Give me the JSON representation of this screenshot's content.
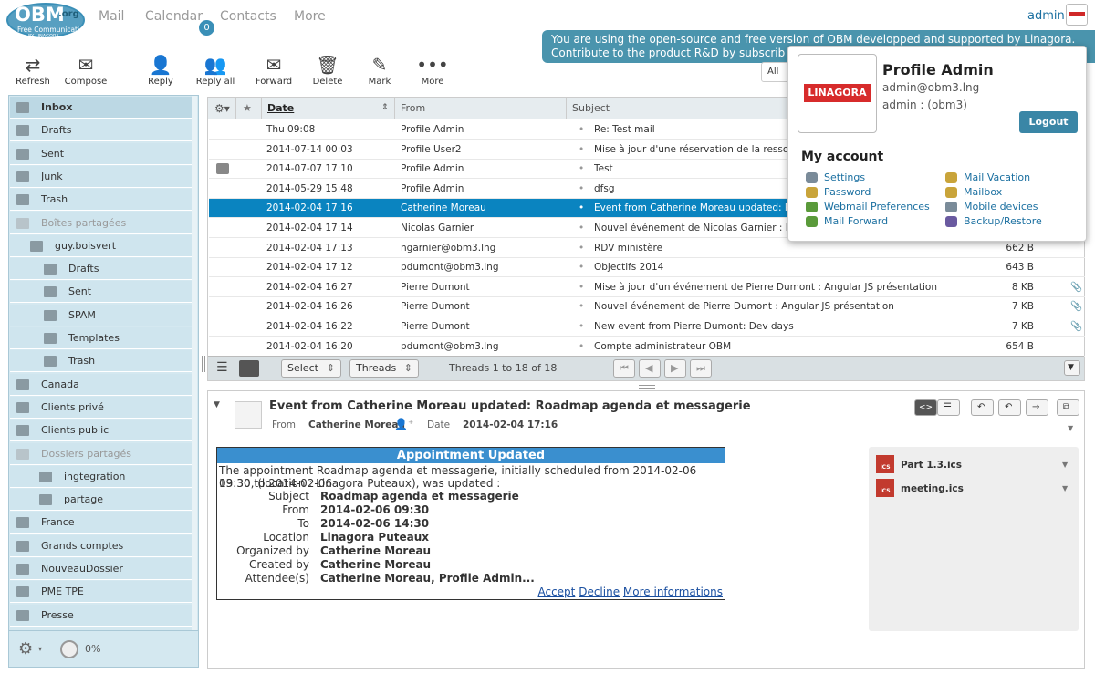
{
  "brand": {
    "logo_text": "OBM",
    "logo_sub": ".org",
    "logo_tagline": "Free Communication",
    "logo_by": "BY LINAGORA"
  },
  "nav": [
    {
      "label": "Mail"
    },
    {
      "label": "Calendar"
    },
    {
      "label": "Contacts"
    },
    {
      "label": "More"
    }
  ],
  "calendar_badge": "0",
  "user": {
    "name": "admin"
  },
  "banner": {
    "line1": "You are using the open-source and free version of OBM developped and supported by Linagora.",
    "line2": "Contribute to the product R&D by subscrib"
  },
  "toolbar": [
    {
      "label": "Refresh",
      "icon": "refresh-icon"
    },
    {
      "label": "Compose",
      "icon": "compose-icon"
    },
    {
      "label": "Reply",
      "icon": "reply-icon"
    },
    {
      "label": "Reply all",
      "icon": "reply-all-icon"
    },
    {
      "label": "Forward",
      "icon": "forward-icon"
    },
    {
      "label": "Delete",
      "icon": "trash-icon"
    },
    {
      "label": "Mark",
      "icon": "mark-icon"
    },
    {
      "label": "More",
      "icon": "more-icon"
    }
  ],
  "filter_value": "All",
  "folders": [
    {
      "label": "Inbox",
      "state": "selected"
    },
    {
      "label": "Drafts"
    },
    {
      "label": "Sent"
    },
    {
      "label": "Junk"
    },
    {
      "label": "Trash"
    },
    {
      "label": "Boîtes partagées",
      "state": "disabled"
    },
    {
      "label": "guy.boisvert"
    },
    {
      "label": "Drafts"
    },
    {
      "label": "Sent"
    },
    {
      "label": "SPAM"
    },
    {
      "label": "Templates"
    },
    {
      "label": "Trash"
    },
    {
      "label": "Canada"
    },
    {
      "label": "Clients privé"
    },
    {
      "label": "Clients public"
    },
    {
      "label": "Dossiers partagés",
      "state": "disabled"
    },
    {
      "label": "ingtegration"
    },
    {
      "label": "partage"
    },
    {
      "label": "France"
    },
    {
      "label": "Grands comptes"
    },
    {
      "label": "NouveauDossier"
    },
    {
      "label": "PME TPE"
    },
    {
      "label": "Presse"
    }
  ],
  "quota": "0%",
  "list": {
    "headers": {
      "date": "Date",
      "from": "From",
      "subject": "Subject"
    },
    "rows": [
      {
        "date": "Thu 09:08",
        "from": "Profile Admin",
        "subject": "Re: Test mail",
        "size": ""
      },
      {
        "date": "2014-07-14 00:03",
        "from": "Profile User2",
        "subject": "Mise à jour d'une réservation de la ressource S",
        "size": ""
      },
      {
        "date": "2014-07-07 17:10",
        "from": "Profile Admin",
        "subject": "Test",
        "size": ""
      },
      {
        "date": "2014-05-29 15:48",
        "from": "Profile Admin",
        "subject": "dfsg",
        "size": ""
      },
      {
        "date": "2014-02-04 17:16",
        "from": "Catherine Moreau",
        "subject": "Event from Catherine Moreau updated: Roadm",
        "size": ""
      },
      {
        "date": "2014-02-04 17:14",
        "from": "Nicolas Garnier",
        "subject": "Nouvel événement de Nicolas Garnier : Point c",
        "size": ""
      },
      {
        "date": "2014-02-04 17:13",
        "from": "ngarnier@obm3.lng",
        "subject": "RDV ministère",
        "size": "662 B"
      },
      {
        "date": "2014-02-04 17:12",
        "from": "pdumont@obm3.lng",
        "subject": "Objectifs 2014",
        "size": "643 B"
      },
      {
        "date": "2014-02-04 16:27",
        "from": "Pierre Dumont",
        "subject": "Mise à jour d'un événement de Pierre Dumont : Angular JS présentation",
        "size": "8 KB"
      },
      {
        "date": "2014-02-04 16:26",
        "from": "Pierre Dumont",
        "subject": "Nouvel événement de Pierre Dumont : Angular JS présentation",
        "size": "7 KB"
      },
      {
        "date": "2014-02-04 16:22",
        "from": "Pierre Dumont",
        "subject": "New event from Pierre Dumont: Dev days",
        "size": "7 KB"
      },
      {
        "date": "2014-02-04 16:20",
        "from": "pdumont@obm3.lng",
        "subject": "Compte administrateur OBM",
        "size": "654 B"
      }
    ],
    "footer": {
      "select_label": "Select",
      "threads_label": "Threads",
      "count": "Threads 1 to 18 of 18"
    }
  },
  "preview": {
    "subject": "Event from Catherine Moreau updated: Roadmap agenda et messagerie",
    "from_label": "From",
    "from_value": "Catherine Moreau",
    "date_label": "Date",
    "date_value": "2014-02-04 17:16",
    "appointment": {
      "title": "Appointment Updated",
      "intro1": "The appointment Roadmap agenda et messagerie, initially scheduled from 2014-02-06 09:30 to 2014-02-06",
      "intro2": "13:30, (location : Linagora Puteaux), was updated :",
      "fields": [
        {
          "k": "Subject",
          "v": "Roadmap agenda et messagerie"
        },
        {
          "k": "From",
          "v": "2014-02-06 09:30"
        },
        {
          "k": "To",
          "v": "2014-02-06 14:30"
        },
        {
          "k": "Location",
          "v": "Linagora Puteaux"
        },
        {
          "k": "Organized by",
          "v": "Catherine Moreau"
        },
        {
          "k": "Created by",
          "v": "Catherine Moreau"
        },
        {
          "k": "Attendee(s)",
          "v": "Catherine Moreau, Profile Admin..."
        }
      ],
      "links": {
        "accept": "Accept",
        "decline": "Decline",
        "more": "More informations"
      }
    },
    "attachments": [
      {
        "name": "Part 1.3.ics"
      },
      {
        "name": "meeting.ics"
      }
    ]
  },
  "account_popup": {
    "logo_text": "LINAGORA",
    "name": "Profile Admin",
    "email": "admin@obm3.lng",
    "login": "admin : (obm3)",
    "logout": "Logout",
    "section": "My account",
    "links_left": [
      "Settings",
      "Password",
      "Webmail Preferences",
      "Mail Forward"
    ],
    "links_right": [
      "Mail Vacation",
      "Mailbox",
      "Mobile devices",
      "Backup/Restore"
    ]
  }
}
